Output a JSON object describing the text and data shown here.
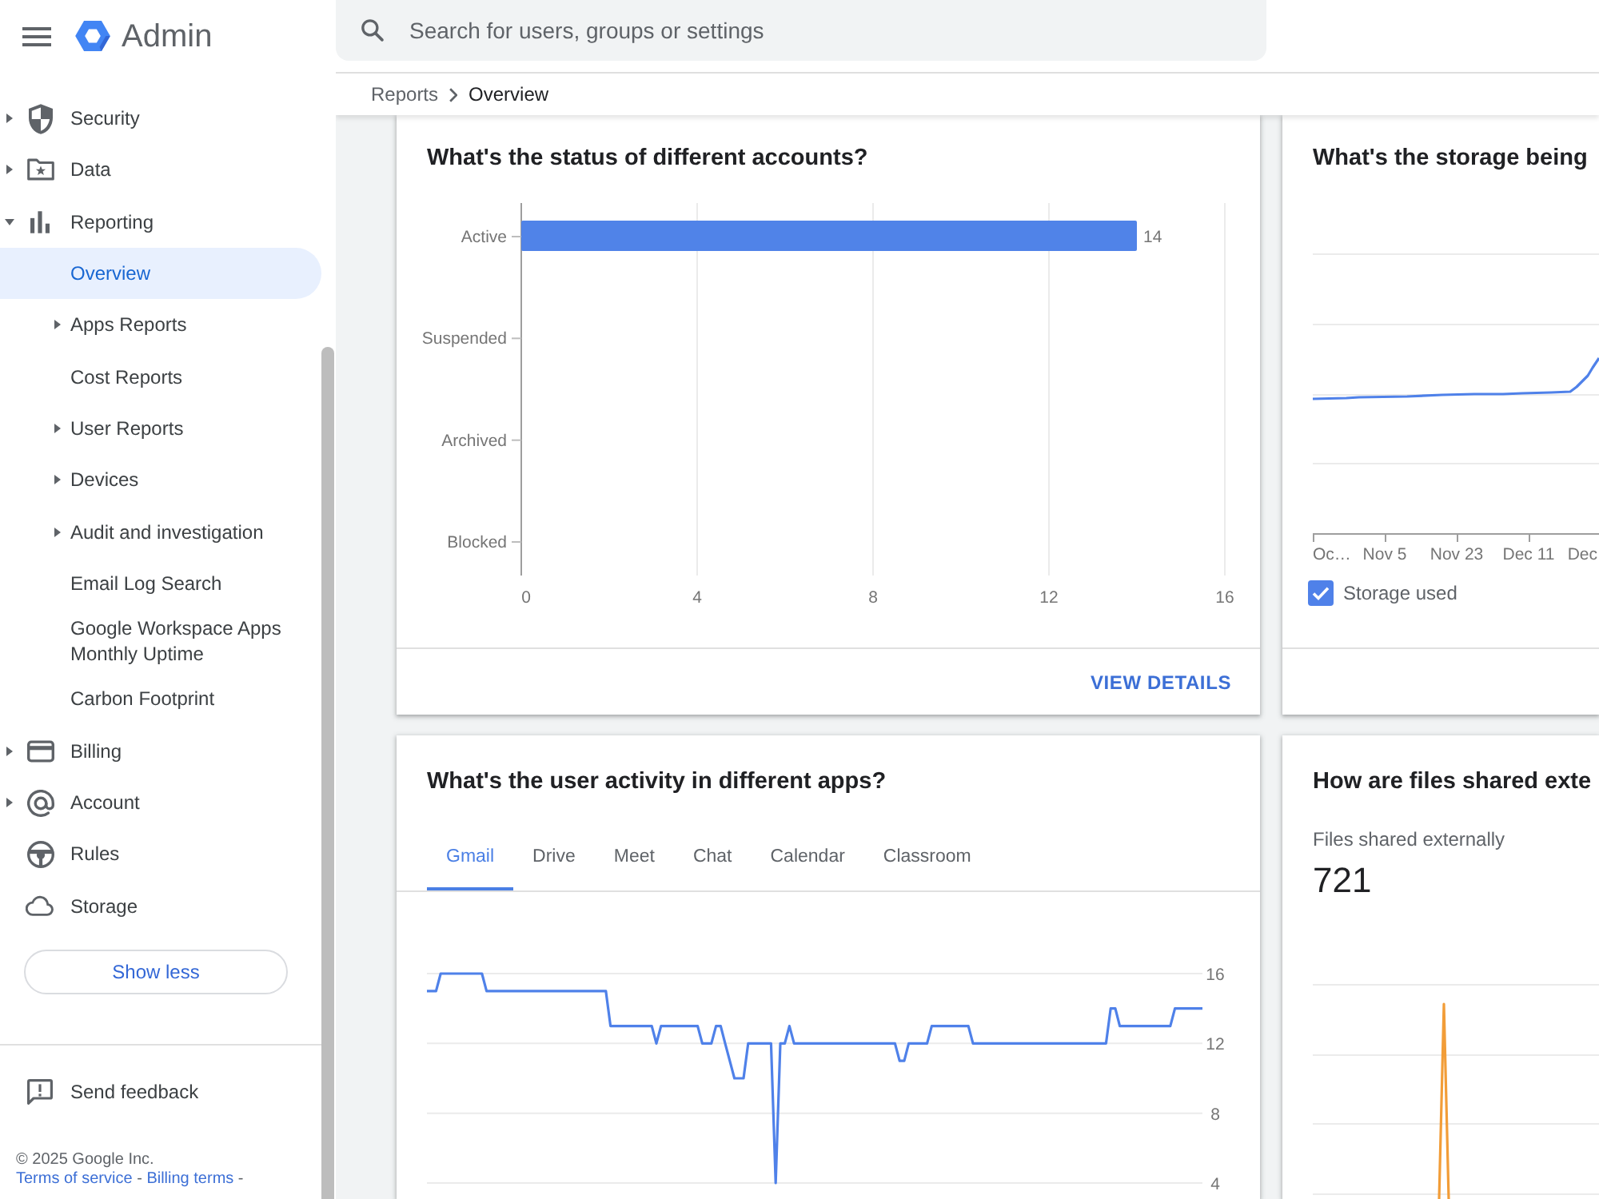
{
  "header": {
    "app_name": "Admin",
    "search": {
      "placeholder": "Search for users, groups or settings"
    }
  },
  "breadcrumbs": [
    {
      "label": "Reports",
      "current": false
    },
    {
      "label": "Overview",
      "current": true
    }
  ],
  "sidebar": {
    "items": [
      {
        "label": "Security",
        "expanded": false,
        "selected": false
      },
      {
        "label": "Data",
        "expanded": false,
        "selected": false
      },
      {
        "label": "Reporting",
        "expanded": true,
        "selected": false,
        "children": [
          {
            "label": "Overview",
            "selected": true
          },
          {
            "label": "Apps Reports",
            "expanded": false,
            "selected": false
          },
          {
            "label": "Cost Reports",
            "selected": false
          },
          {
            "label": "User Reports",
            "expanded": false,
            "selected": false
          },
          {
            "label": "Devices",
            "expanded": false,
            "selected": false
          },
          {
            "label": "Audit and investigation",
            "expanded": false,
            "selected": false
          },
          {
            "label": "Email Log Search",
            "selected": false
          },
          {
            "label": "Google Workspace Apps Monthly Uptime",
            "selected": false
          },
          {
            "label": "Carbon Footprint",
            "selected": false
          }
        ]
      },
      {
        "label": "Billing",
        "expanded": false,
        "selected": false
      },
      {
        "label": "Account",
        "expanded": false,
        "selected": false
      },
      {
        "label": "Rules",
        "selected": false
      },
      {
        "label": "Storage",
        "selected": false
      }
    ],
    "show_less_button": "Show less",
    "feedback": "Send feedback",
    "copyright": "© 2025 Google Inc.",
    "footer_links": [
      {
        "label": "Terms of service",
        "separator": "-"
      },
      {
        "label": "Billing terms",
        "separator": "-"
      }
    ]
  },
  "cards": [
    {
      "kind": "bar_chart",
      "title": "What's the status of different accounts?",
      "chart_data": {
        "type": "bar",
        "orientation": "horizontal",
        "categories": [
          "Active",
          "Suspended",
          "Archived",
          "Blocked"
        ],
        "series": [
          {
            "color": "#5083e8",
            "values": [
              14,
              0,
              0,
              0
            ]
          }
        ],
        "xlim": [
          0,
          16
        ],
        "xticks": [
          0,
          4,
          8,
          12,
          16
        ],
        "grid": true,
        "value_labels": [
          "14",
          null,
          null,
          null
        ]
      },
      "action": "VIEW DETAILS"
    },
    {
      "kind": "storage_chart",
      "title": "What's the storage being",
      "x_labels": [
        "Oc…",
        "Nov 5",
        "Nov 23",
        "Dec 11",
        "Dec"
      ],
      "legend": {
        "label": "Storage used",
        "checked": true
      }
    },
    {
      "kind": "activity_chart",
      "title": "What's the user activity in different apps?",
      "tabs": [
        {
          "label": "Gmail",
          "selected": true
        },
        {
          "label": "Drive",
          "selected": false
        },
        {
          "label": "Meet",
          "selected": false
        },
        {
          "label": "Chat",
          "selected": false
        },
        {
          "label": "Calendar",
          "selected": false
        },
        {
          "label": "Classroom",
          "selected": false
        }
      ],
      "chart_data": {
        "type": "line",
        "ylim": [
          4,
          16
        ],
        "yticks": [
          4,
          8,
          12,
          16
        ],
        "grid": true,
        "series": [
          {
            "color": "#4f81e9",
            "values": [
              15,
              15,
              15,
              16,
              16,
              16,
              16,
              16,
              16,
              16,
              16,
              16,
              16,
              15,
              15,
              15,
              15,
              15,
              15,
              15,
              15,
              15,
              15,
              15,
              15,
              15,
              15,
              15,
              15,
              15,
              15,
              15,
              15,
              15,
              15,
              15,
              15,
              15,
              15,
              15,
              13,
              13,
              13,
              13,
              13,
              13,
              13,
              13,
              13,
              13,
              12,
              13,
              13,
              13,
              13,
              13,
              13,
              13,
              13,
              13,
              12,
              12,
              12,
              13,
              13,
              12,
              11,
              10,
              10,
              10,
              12,
              12,
              12,
              12,
              12,
              12,
              4,
              12,
              12,
              13,
              12,
              12,
              12,
              12,
              12,
              12,
              12,
              12,
              12,
              12,
              12,
              12,
              12,
              12,
              12,
              12,
              12,
              12,
              12,
              12,
              12,
              12,
              12,
              11,
              11,
              12,
              12,
              12,
              12,
              12,
              13,
              13,
              13,
              13,
              13,
              13,
              13,
              13,
              13,
              12,
              12,
              12,
              12,
              12,
              12,
              12,
              12,
              12,
              12,
              12,
              12,
              12,
              12,
              12,
              12,
              12,
              12,
              12,
              12,
              12,
              12,
              12,
              12,
              12,
              12,
              12,
              12,
              12,
              12,
              14,
              14,
              13,
              13,
              13,
              13,
              13,
              13,
              13,
              13,
              13,
              13,
              13,
              13,
              14,
              14,
              14,
              14,
              14,
              14,
              14
            ]
          }
        ]
      }
    },
    {
      "kind": "files_chart",
      "title": "How are files shared exte",
      "metric_label": "Files shared externally",
      "metric_value": "721"
    }
  ]
}
